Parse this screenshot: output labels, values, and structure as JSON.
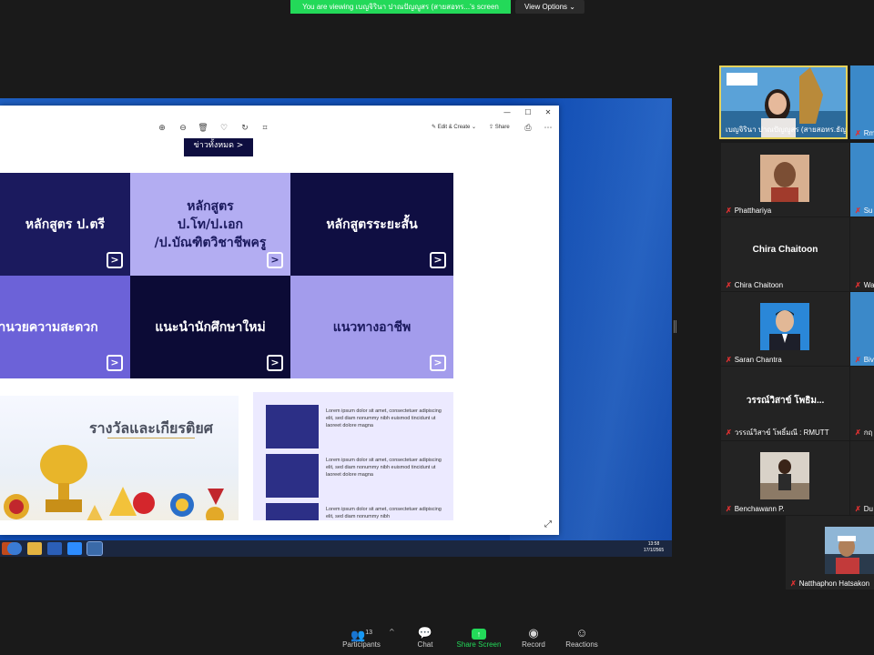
{
  "banner": {
    "text": "You are viewing เบญจิรินา ปาณปัญญูสร (สายสอทร...'s screen",
    "view_options": "View Options"
  },
  "window": {
    "controls": {
      "minimize": "—",
      "maximize": "☐",
      "close": "✕"
    },
    "toolbar": {
      "edit_create": "Edit & Create",
      "share": "Share"
    }
  },
  "page": {
    "all_news_button": "ข่าวทั้งหมด >",
    "tiles": [
      {
        "label": "หลักสูตร ป.ตรี",
        "color": "#1b1a5e"
      },
      {
        "label": "หลักสูตร\nป.โท/ป.เอก\n/ป.บัณฑิตวิชาชีพครู",
        "color": "#b3adf2"
      },
      {
        "label": "หลักสูตรระยะสั้น",
        "color": "#0f0e42"
      },
      {
        "label": "อำนวยความสะดวก",
        "color": "#6c62d8"
      },
      {
        "label": "แนะนำนักศึกษาใหม่",
        "color": "#0c0b36"
      },
      {
        "label": "แนวทางอาชีพ",
        "color": "#a39cec"
      }
    ],
    "awards_title": "รางวัลและเกียรติยศ",
    "news": [
      {
        "text": "Lorem ipsum dolor sit amet, consectetuer adipiscing elit, sed diam nonummy nibh euismod tincidunt ut laoreet dolore magna"
      },
      {
        "text": "Lorem ipsum dolor sit amet, consectetuer adipiscing elit, sed diam nonummy nibh euismod tincidunt ut laoreet dolore magna"
      },
      {
        "text": "Lorem ipsum dolor sit amet, consectetuer adipiscing elit, sed diam nonummy nibh"
      }
    ]
  },
  "taskbar": {
    "time": "13:58",
    "date": "17/1/2565"
  },
  "participants_gallery": [
    {
      "name": "เบญจิรินา ปาณปัญญูสร (สายสอทร.ธัญ...",
      "mic_off": false,
      "active": true
    },
    {
      "name": "Rm",
      "mic_off": true
    },
    {
      "name": "Phatthariya",
      "mic_off": true
    },
    {
      "name": "Su",
      "mic_off": true
    },
    {
      "name": "Chira Chaitoon",
      "display": "Chira Chaitoon",
      "mic_off": true
    },
    {
      "name": "Wa",
      "mic_off": true
    },
    {
      "name": "Saran Chantra",
      "mic_off": true
    },
    {
      "name": "Biv",
      "mic_off": true
    },
    {
      "name": "วรรณ์วิสาข์ โพธิ์มณี : RMUTT",
      "display": "วรรณ์วิสาข์ โพธิม...",
      "mic_off": true
    },
    {
      "name": "กฤ",
      "mic_off": true
    },
    {
      "name": "Benchawann P.",
      "mic_off": true
    },
    {
      "name": "Du",
      "mic_off": true
    },
    {
      "name": "Natthaphon Hatsakon",
      "mic_off": true
    }
  ],
  "toolbar": {
    "participants": "Participants",
    "participants_count": "13",
    "chat": "Chat",
    "share_screen": "Share Screen",
    "record": "Record",
    "reactions": "Reactions"
  }
}
